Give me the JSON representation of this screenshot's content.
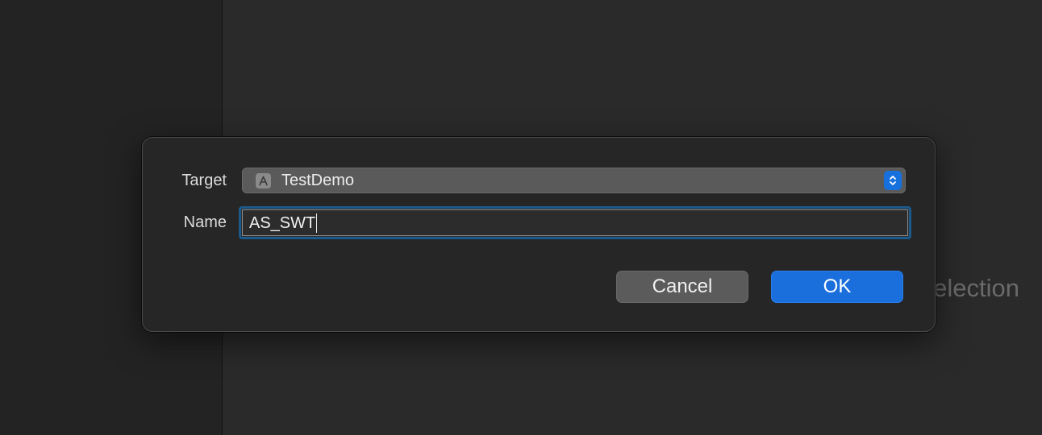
{
  "background": {
    "hint_text": "Selection"
  },
  "dialog": {
    "target_label": "Target",
    "target_value": "TestDemo",
    "target_icon": "app-icon",
    "name_label": "Name",
    "name_value": "AS_SWT",
    "cancel_label": "Cancel",
    "ok_label": "OK"
  },
  "colors": {
    "accent": "#1a6fdd",
    "focus_ring": "#1b5a8c"
  }
}
